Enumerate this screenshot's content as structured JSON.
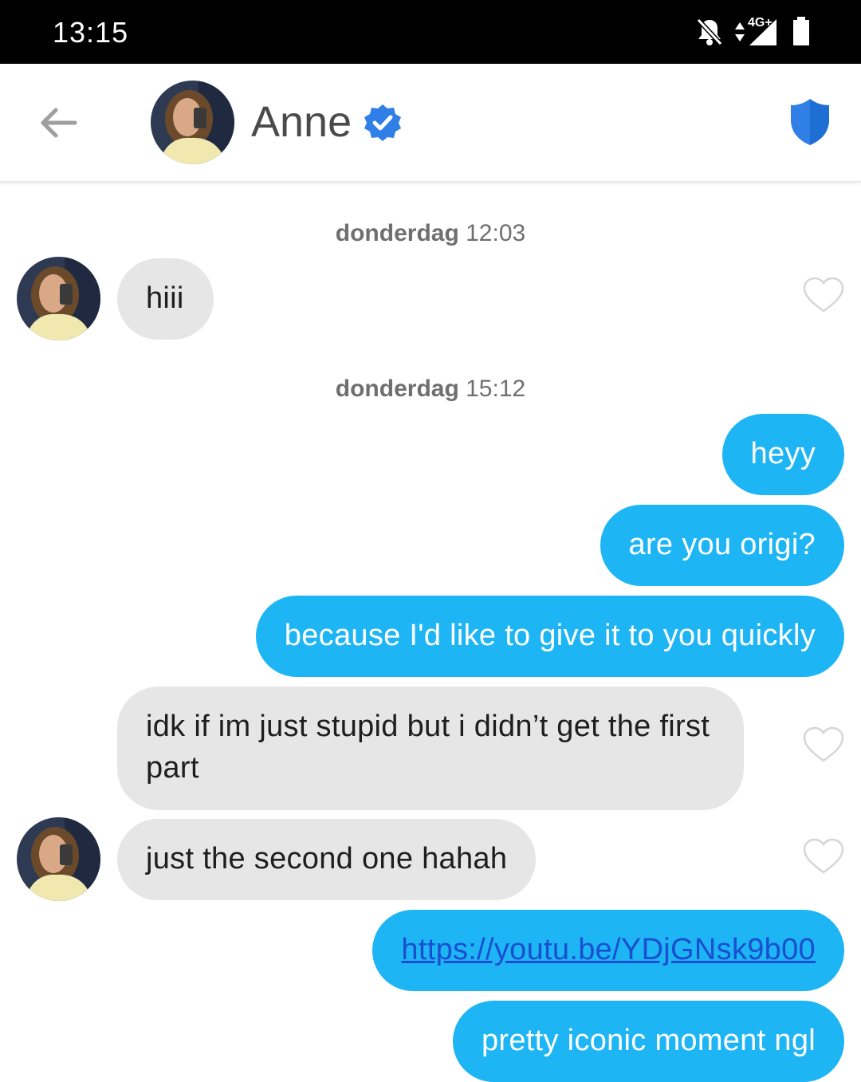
{
  "status_bar": {
    "time": "13:15",
    "network_label": "4G+",
    "icons": [
      "bell-off-icon",
      "data-arrows-icon",
      "signal-icon",
      "battery-icon"
    ]
  },
  "header": {
    "contact_name": "Anne",
    "icons": [
      "back-arrow-icon",
      "verified-badge-icon",
      "shield-icon"
    ],
    "colors": {
      "verified": "#2f7fe6",
      "shield": "#2f7fe6"
    }
  },
  "messages": [
    {
      "type": "timestamp",
      "day": "donderdag",
      "time": "12:03"
    },
    {
      "type": "incoming",
      "text": "hiii"
    },
    {
      "type": "timestamp",
      "day": "donderdag",
      "time": "15:12"
    },
    {
      "type": "outgoing",
      "text": "heyy"
    },
    {
      "type": "outgoing",
      "text": "are you origi?"
    },
    {
      "type": "outgoing",
      "text": "because I'd like to give it to you quickly"
    },
    {
      "type": "incoming",
      "text": "idk if im just stupid but i didn’t get the first part"
    },
    {
      "type": "incoming",
      "text": "just the second one hahah"
    },
    {
      "type": "outgoing",
      "text": "https://youtu.be/YDjGNsk9b00",
      "is_link": true
    },
    {
      "type": "outgoing",
      "text": "pretty iconic moment ngl"
    }
  ],
  "colors": {
    "outgoing_bubble": "#1eb5f5",
    "incoming_bubble": "#e6e6e6",
    "link": "#1a4fcf"
  }
}
